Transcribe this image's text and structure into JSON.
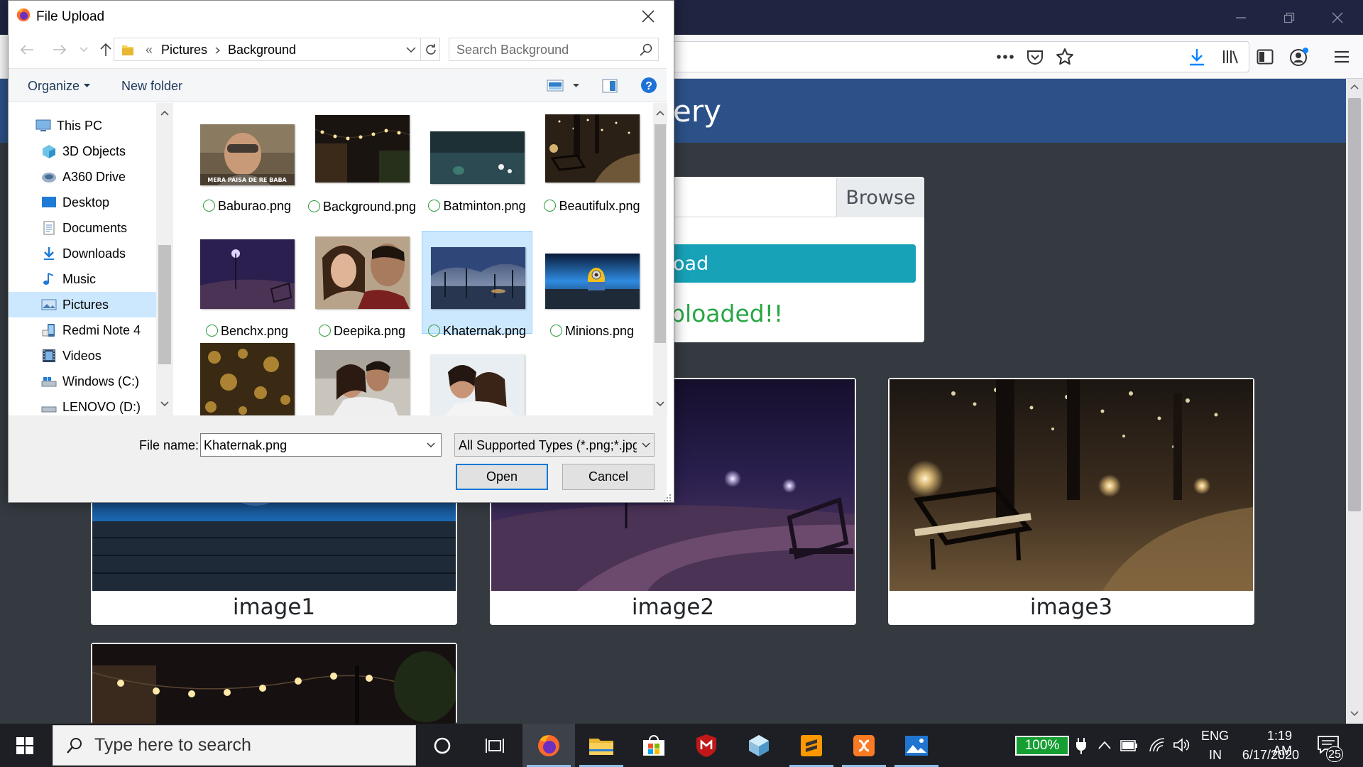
{
  "browser": {
    "site_title": "ery",
    "browse_label": "Browse",
    "upload_label": "oad",
    "upload_status": "ploaded!!",
    "gallery": [
      {
        "caption": "image1"
      },
      {
        "caption": "image2"
      },
      {
        "caption": "image3"
      }
    ]
  },
  "dialog": {
    "title": "File Upload",
    "breadcrumb": [
      "Pictures",
      "Background"
    ],
    "search_placeholder": "Search Background",
    "toolbar": {
      "organize": "Organize",
      "new_folder": "New folder"
    },
    "nav_items": [
      {
        "label": "This PC",
        "icon": "computer-icon"
      },
      {
        "label": "3D Objects",
        "icon": "cube-icon"
      },
      {
        "label": "A360 Drive",
        "icon": "cloud-drive-icon"
      },
      {
        "label": "Desktop",
        "icon": "desktop-icon"
      },
      {
        "label": "Documents",
        "icon": "documents-icon"
      },
      {
        "label": "Downloads",
        "icon": "download-icon"
      },
      {
        "label": "Music",
        "icon": "music-icon"
      },
      {
        "label": "Pictures",
        "icon": "pictures-icon",
        "selected": true
      },
      {
        "label": "Redmi Note 4",
        "icon": "phone-icon"
      },
      {
        "label": "Videos",
        "icon": "videos-icon"
      },
      {
        "label": "Windows (C:)",
        "icon": "drive-icon"
      },
      {
        "label": "LENOVO (D:)",
        "icon": "drive-icon"
      }
    ],
    "files": [
      {
        "name": "Baburao.png",
        "caption_in_image": "MERA PAISA DE RE BABA"
      },
      {
        "name": "Background.png"
      },
      {
        "name": "Batminton.png"
      },
      {
        "name": "Beautifulx.png"
      },
      {
        "name": "Benchx.png"
      },
      {
        "name": "Deepika.png"
      },
      {
        "name": "Khaternak.png",
        "selected": true
      },
      {
        "name": "Minions.png"
      },
      {
        "name": ""
      },
      {
        "name": ""
      },
      {
        "name": ""
      }
    ],
    "file_name_label": "File name:",
    "file_name_value": "Khaternak.png",
    "file_type": "All Supported Types (*.png;*.jpg",
    "open_label": "Open",
    "cancel_label": "Cancel"
  },
  "taskbar": {
    "search_placeholder": "Type here to search",
    "battery": "100%",
    "lang_line1": "ENG",
    "lang_line2": "IN",
    "time": "1:19 AM",
    "date": "6/17/2020",
    "notifications": "25"
  },
  "colors": {
    "accent": "#0078d7",
    "site_header": "#2c5188",
    "upload_button": "#17a2b8",
    "success_text": "#28a745"
  }
}
